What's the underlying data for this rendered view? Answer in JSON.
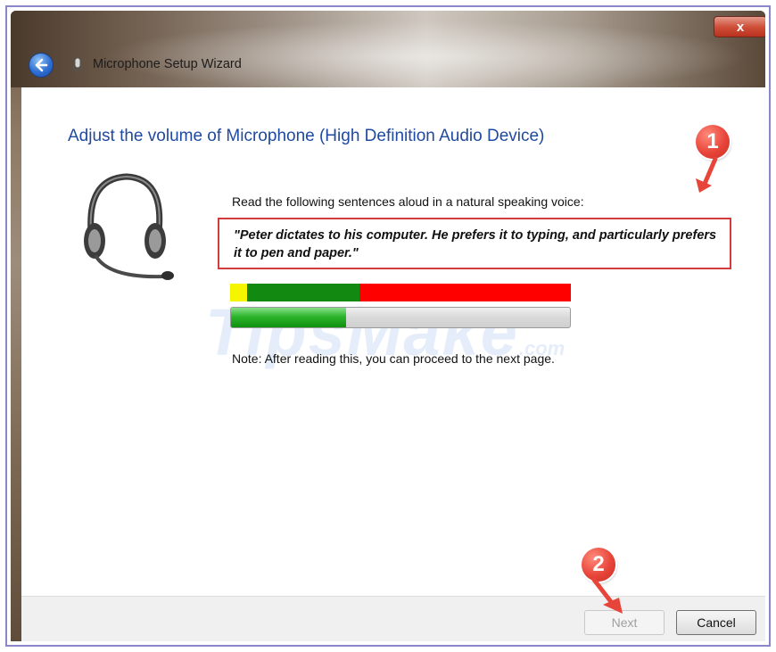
{
  "window": {
    "title": "Microphone Setup Wizard",
    "close_label": "x"
  },
  "content": {
    "heading": "Adjust the volume of Microphone (High Definition Audio Device)",
    "instruction": "Read the following sentences aloud in a natural speaking voice:",
    "quote": "\"Peter dictates to his computer. He prefers it to typing, and particularly prefers it to pen and paper.\"",
    "note": "Note: After reading this, you can proceed to the next page.",
    "level_meter": {
      "segments": [
        {
          "color": "#f5f500",
          "fraction": 0.05
        },
        {
          "color": "#128a12",
          "fraction": 0.33
        },
        {
          "color": "#ff0000",
          "fraction": 0.62
        }
      ]
    },
    "volume_progress_fraction": 0.34
  },
  "footer": {
    "next_label": "Next",
    "cancel_label": "Cancel"
  },
  "annotations": {
    "badge1": "1",
    "badge2": "2",
    "color": "#e8453a"
  },
  "watermark": {
    "text": "TipsMake",
    "suffix": ".com"
  },
  "icons": [
    "back-arrow-icon",
    "microphone-icon",
    "headset-icon",
    "close-icon"
  ]
}
